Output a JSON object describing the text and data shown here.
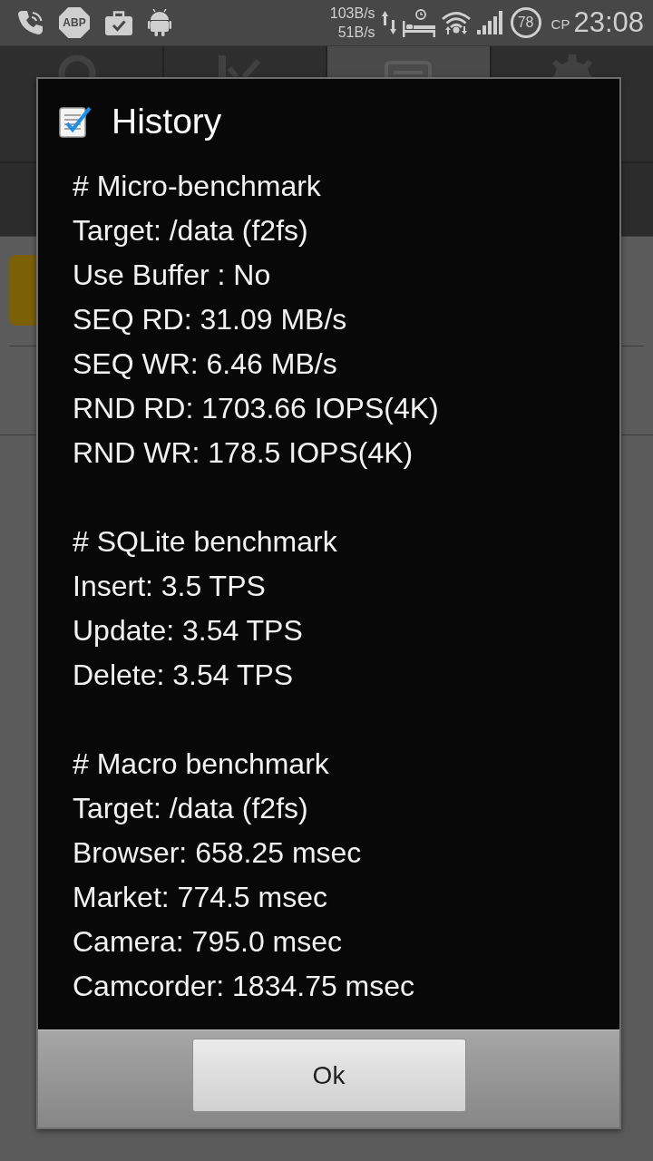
{
  "status_bar": {
    "adblock_label": "ABP",
    "upload_speed": "103B/s",
    "download_speed": "51B/s",
    "battery": "78",
    "day": "СР",
    "time": "23:08"
  },
  "app": {
    "tabs": [
      {
        "selected": false
      },
      {
        "selected": false
      },
      {
        "selected": true
      },
      {
        "selected": false
      }
    ]
  },
  "dialog": {
    "title": "History",
    "sections": [
      {
        "heading": "# Micro-benchmark",
        "lines": [
          "Target: /data (f2fs)",
          "Use Buffer : No",
          "SEQ RD: 31.09 MB/s",
          "SEQ WR: 6.46 MB/s",
          "RND RD: 1703.66 IOPS(4K)",
          "RND WR: 178.5 IOPS(4K)"
        ]
      },
      {
        "heading": "# SQLite benchmark",
        "lines": [
          "Insert: 3.5 TPS",
          "Update: 3.54 TPS",
          "Delete: 3.54 TPS"
        ]
      },
      {
        "heading": "# Macro benchmark",
        "lines": [
          "Target: /data (f2fs)",
          "Browser: 658.25 msec",
          "Market: 774.5 msec",
          "Camera: 795.0 msec",
          "Camcorder: 1834.75 msec"
        ]
      }
    ],
    "buttons": [
      "Ok"
    ]
  }
}
